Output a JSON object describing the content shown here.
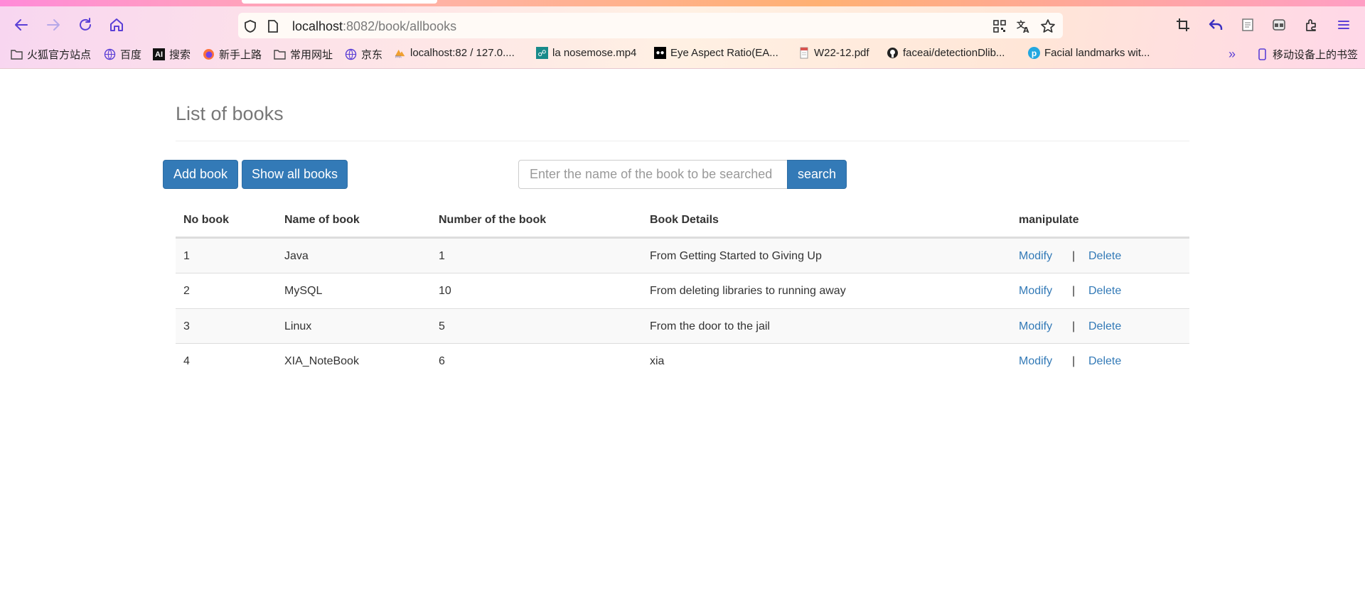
{
  "browser": {
    "url_host": "localhost",
    "url_path": ":8082/book/allbooks",
    "bookmarks": [
      {
        "label": "火狐官方站点",
        "icon": "folder-icon"
      },
      {
        "label": "百度",
        "icon": "globe-icon"
      },
      {
        "label": "搜索",
        "icon": "ai-icon"
      },
      {
        "label": "新手上路",
        "icon": "firefox-icon"
      },
      {
        "label": "常用网址",
        "icon": "folder-icon"
      },
      {
        "label": "京东",
        "icon": "globe-icon"
      },
      {
        "label": "localhost:82 / 127.0....",
        "icon": "phpmyadmin-icon"
      },
      {
        "label": "la nosemose.mp4",
        "icon": "video-icon"
      },
      {
        "label": "Eye Aspect Ratio(EA...",
        "icon": "medium-icon"
      },
      {
        "label": "W22-12.pdf",
        "icon": "pdf-icon"
      },
      {
        "label": "faceai/detectionDlib...",
        "icon": "github-icon"
      },
      {
        "label": "Facial landmarks wit...",
        "icon": "p-icon"
      }
    ],
    "mobile_bookmarks": "移动设备上的书签"
  },
  "page": {
    "title": "List of books",
    "add_button": "Add book",
    "show_all_button": "Show all books",
    "search_placeholder": "Enter the name of the book to be searched",
    "search_button": "search"
  },
  "table": {
    "headers": [
      "No book",
      "Name of book",
      "Number of the book",
      "Book Details",
      "manipulate"
    ],
    "rows": [
      {
        "no": "1",
        "name": "Java",
        "number": "1",
        "details": "From Getting Started to Giving Up"
      },
      {
        "no": "2",
        "name": "MySQL",
        "number": "10",
        "details": "From deleting libraries to running away"
      },
      {
        "no": "3",
        "name": "Linux",
        "number": "5",
        "details": "From the door to the jail"
      },
      {
        "no": "4",
        "name": "XIA_NoteBook",
        "number": "6",
        "details": "xia"
      }
    ],
    "modify_label": "Modify",
    "separator": "|",
    "delete_label": "Delete"
  },
  "colors": {
    "primary": "#337ab7",
    "chrome_accent": "#5b3fd6"
  }
}
